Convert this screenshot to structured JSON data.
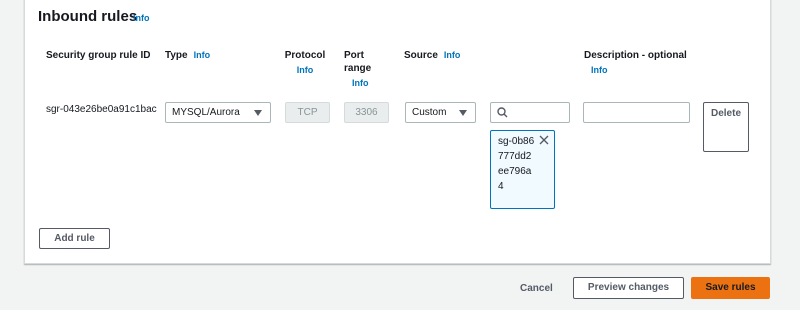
{
  "panel": {
    "title": "Inbound rules",
    "title_info": "Info"
  },
  "columns": {
    "rule_id": {
      "label": "Security group rule ID"
    },
    "type": {
      "label": "Type",
      "info": "Info"
    },
    "protocol": {
      "label": "Protocol",
      "info": "Info"
    },
    "port_range": {
      "label_line1": "Port",
      "label_line2": "range",
      "info": "Info"
    },
    "source": {
      "label": "Source",
      "info": "Info"
    },
    "description": {
      "label": "Description - optional",
      "info": "Info"
    }
  },
  "rule": {
    "rule_id": "sgr-043e26be0a91c1bac",
    "type_value": "MYSQL/Aurora",
    "protocol_value": "TCP",
    "port_value": "3306",
    "source_value": "Custom",
    "search_value": "",
    "description_value": "",
    "token": "sg-0b86777dd2ee796a4",
    "delete_label": "Delete"
  },
  "buttons": {
    "add_rule": "Add rule",
    "cancel": "Cancel",
    "preview": "Preview changes",
    "save": "Save rules"
  },
  "icons": {
    "search": "search-icon",
    "close": "close-icon",
    "caret": "caret-down-icon"
  },
  "colors": {
    "link": "#0073bb",
    "primary": "#ec7211",
    "border": "#aab7b8",
    "background": "#f2f3f3"
  }
}
